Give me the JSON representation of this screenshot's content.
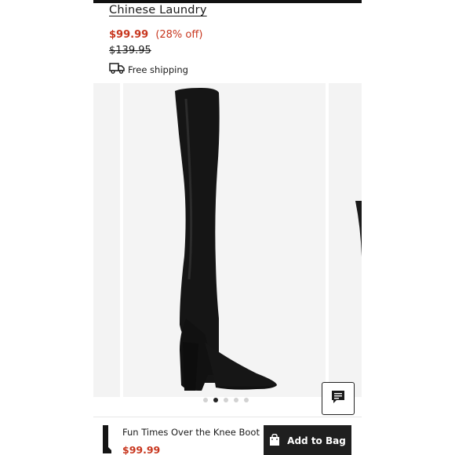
{
  "product": {
    "brand": "Chinese Laundry",
    "price": "$99.99",
    "discount": "(28% off)",
    "original_price": "$139.95",
    "shipping": "Free shipping",
    "title": "Fun Times Over the Knee Boot"
  },
  "carousel": {
    "slide_count": 5,
    "active_index": 1
  },
  "bottom_bar": {
    "price": "$99.99",
    "add_to_bag_label": "Add to Bag"
  },
  "icons": {
    "truck": "truck-icon",
    "chat": "chat-icon",
    "bag": "shopping-bag-icon"
  },
  "colors": {
    "sale": "#c8361e",
    "button": "#1f1f1f"
  }
}
